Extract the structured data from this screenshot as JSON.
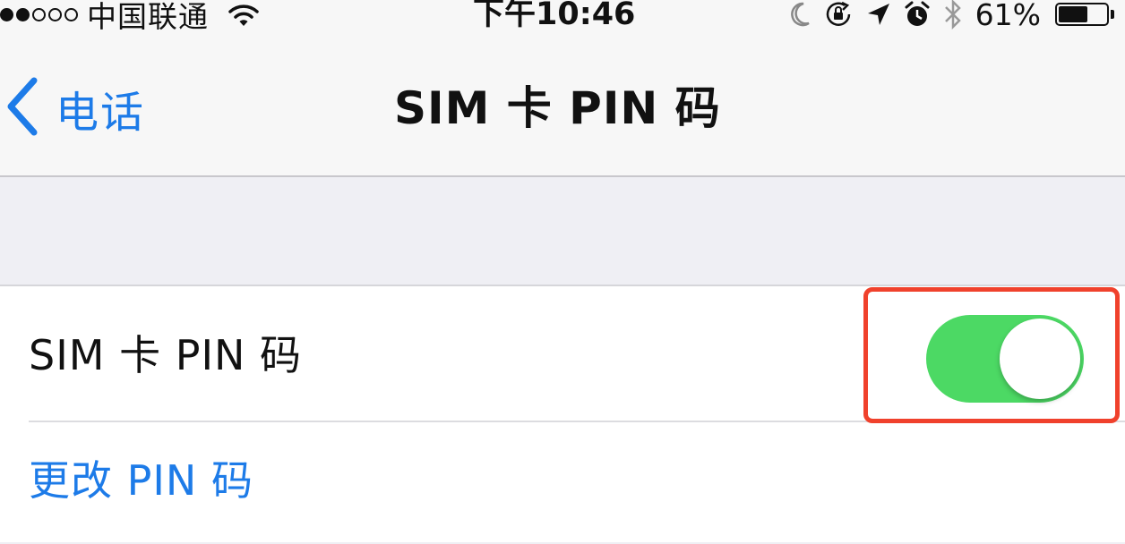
{
  "status_bar": {
    "signal_filled": 2,
    "signal_total": 5,
    "carrier": "中国联通",
    "wifi_icon": "wifi-icon",
    "time": "下午10:46",
    "icons": [
      "moon-icon",
      "rotation-lock-icon",
      "location-arrow-icon",
      "alarm-icon",
      "bluetooth-icon"
    ],
    "battery_percent": "61%",
    "battery_level": 0.61
  },
  "nav": {
    "back_label": "电话",
    "title": "SIM 卡 PIN 码"
  },
  "settings": {
    "sim_pin_label": "SIM 卡 PIN 码",
    "sim_pin_enabled": true,
    "change_pin_label": "更改 PIN 码"
  },
  "colors": {
    "accent": "#1d7be8",
    "toggle_on": "#4cd964",
    "highlight": "#f0412c",
    "background": "#efeff4"
  }
}
